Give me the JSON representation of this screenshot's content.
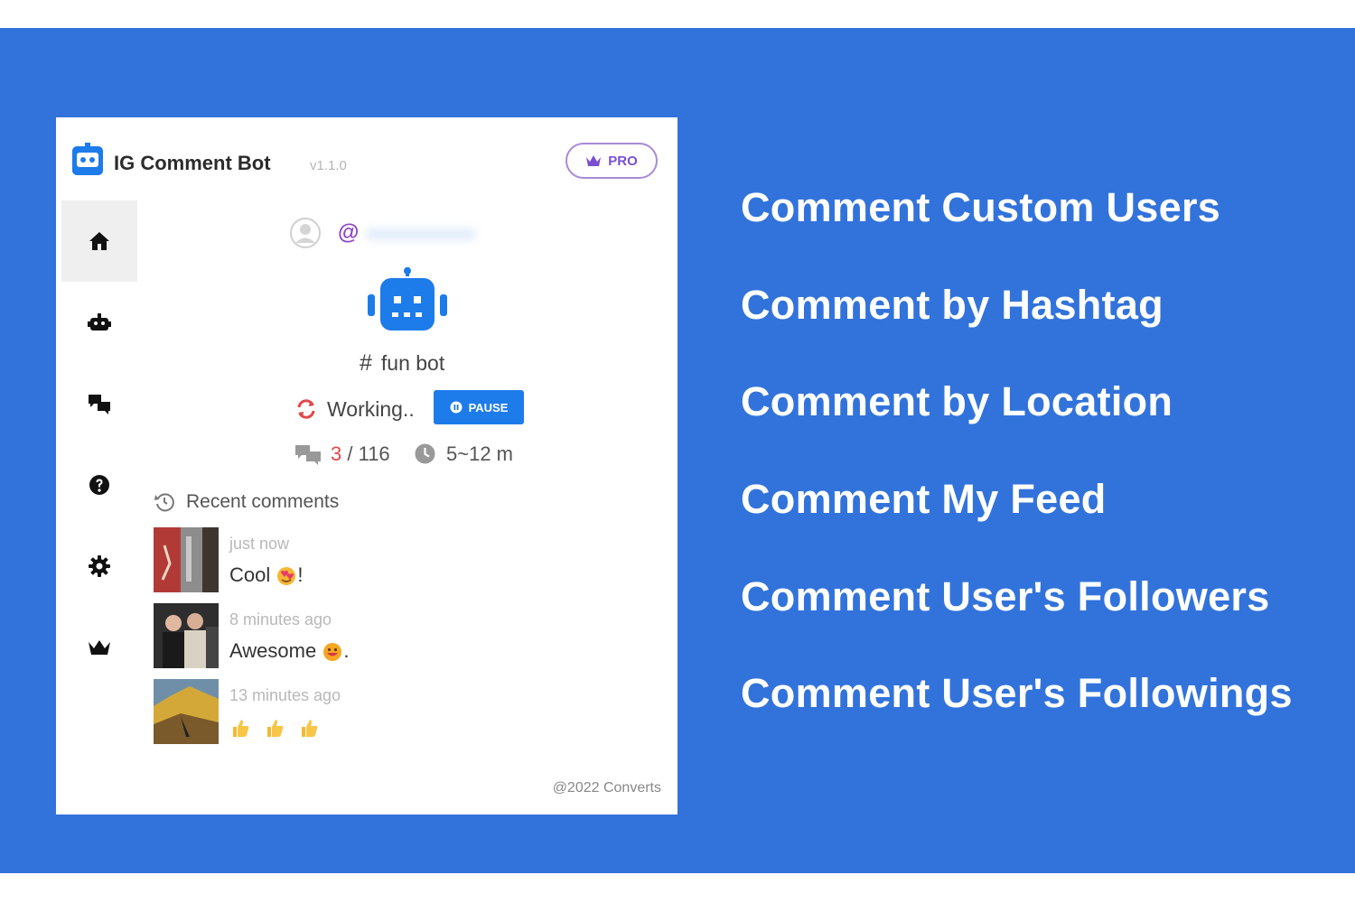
{
  "colors": {
    "banner_bg": "#3273db",
    "accent_blue": "#1d7bea",
    "pro_purple": "#7b4fd0",
    "count_red": "#e24848"
  },
  "app": {
    "title": "IG Comment Bot",
    "version": "v1.1.0",
    "pro_label": "PRO"
  },
  "sidebar": {
    "items": [
      {
        "icon": "home-icon",
        "active": true
      },
      {
        "icon": "robot-icon",
        "active": false
      },
      {
        "icon": "comments-icon",
        "active": false
      },
      {
        "icon": "help-icon",
        "active": false
      },
      {
        "icon": "gear-icon",
        "active": false
      },
      {
        "icon": "crown-icon",
        "active": false
      }
    ]
  },
  "user": {
    "at": "@",
    "username_blurred": "xxxxxxxxxxxx"
  },
  "bot": {
    "hash": "#",
    "name": "fun bot",
    "status": "Working..",
    "pause_label": "PAUSE",
    "stats": {
      "current": "3",
      "separator": " / ",
      "total": "116",
      "interval": "5~12 m"
    }
  },
  "recent": {
    "title": "Recent comments",
    "items": [
      {
        "time": "just now",
        "text": "Cool",
        "suffix": "!"
      },
      {
        "time": "8 minutes ago",
        "text": "Awesome",
        "suffix": "."
      },
      {
        "time": "13 minutes ago",
        "text": "",
        "suffix": ""
      }
    ]
  },
  "footer": {
    "copyright": "@2022 Converts"
  },
  "features": [
    "Comment Custom Users",
    "Comment by Hashtag",
    "Comment by Location",
    "Comment My Feed",
    "Comment User's Followers",
    "Comment User's Followings"
  ]
}
